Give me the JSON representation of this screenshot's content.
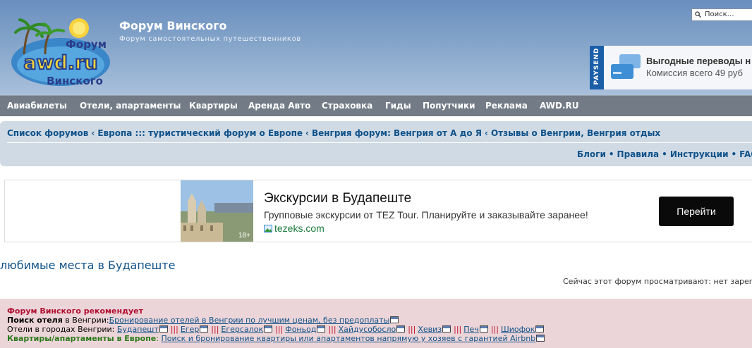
{
  "header": {
    "logo_text_top": "Форум",
    "logo_text_main": "awd.ru",
    "logo_text_bottom": "Винского",
    "site_title": "Форум Винского",
    "site_description": "Форум самостоятельных путешественников",
    "search_placeholder": "Поиск…",
    "banner": {
      "brand": "PAYSEND",
      "title": "Выгодные переводы н",
      "subtitle": "Комиссия всего 49 руб"
    }
  },
  "navbar": {
    "items": [
      "Авиабилеты",
      "Отели, апартаменты",
      "Квартиры",
      "Аренда Авто",
      "Страховка",
      "Гиды",
      "Попутчики",
      "Реклама",
      "AWD.RU"
    ]
  },
  "breadcrumb": {
    "separator": "‹",
    "items": [
      "Список форумов",
      "Европа ::: туристический форум о Европе",
      "Венгрия форум: Венгрия от А до Я",
      "Отзывы о Венгрии, Венгрия отдых"
    ]
  },
  "quick_links": {
    "items": [
      "Блоги",
      "Правила",
      "Инструкции",
      "FAQ"
    ],
    "separator": "•"
  },
  "ad": {
    "title": "Экскурсии в Будапеште",
    "description": "Групповые экскурсии от TEZ Tour. Планируйте и заказывайте заранее!",
    "domain": "tezeks.com",
    "age_rating": "18+",
    "button": "Перейти"
  },
  "forum": {
    "title": "любимые места в Будапеште",
    "viewers": "Сейчас этот форум просматривают: нет зарег"
  },
  "recommend": {
    "title": "Форум Винского рекомендует",
    "hotel_search_label": "Поиск отеля",
    "hotel_search_rest": " в Венгрии:",
    "hotel_search_link": "Бронирование отелей в Венгрии по лучшим ценам, без предоплаты",
    "cities_label": "Отели в городах Венгрии: ",
    "cities": [
      "Будапешт",
      "Егер",
      "Егерсалок",
      "Фоньод",
      "Хайдусобосло",
      "Хевиз",
      "Печ",
      "Шиофок"
    ],
    "bars": "|||",
    "apartments_label": "Квартиры/апартаменты в Европе",
    "apartments_colon": ": ",
    "apartments_link": "Поиск и бронирование квартиры или апартаментов напрямую у хозяев с гарантией Airbnb"
  }
}
